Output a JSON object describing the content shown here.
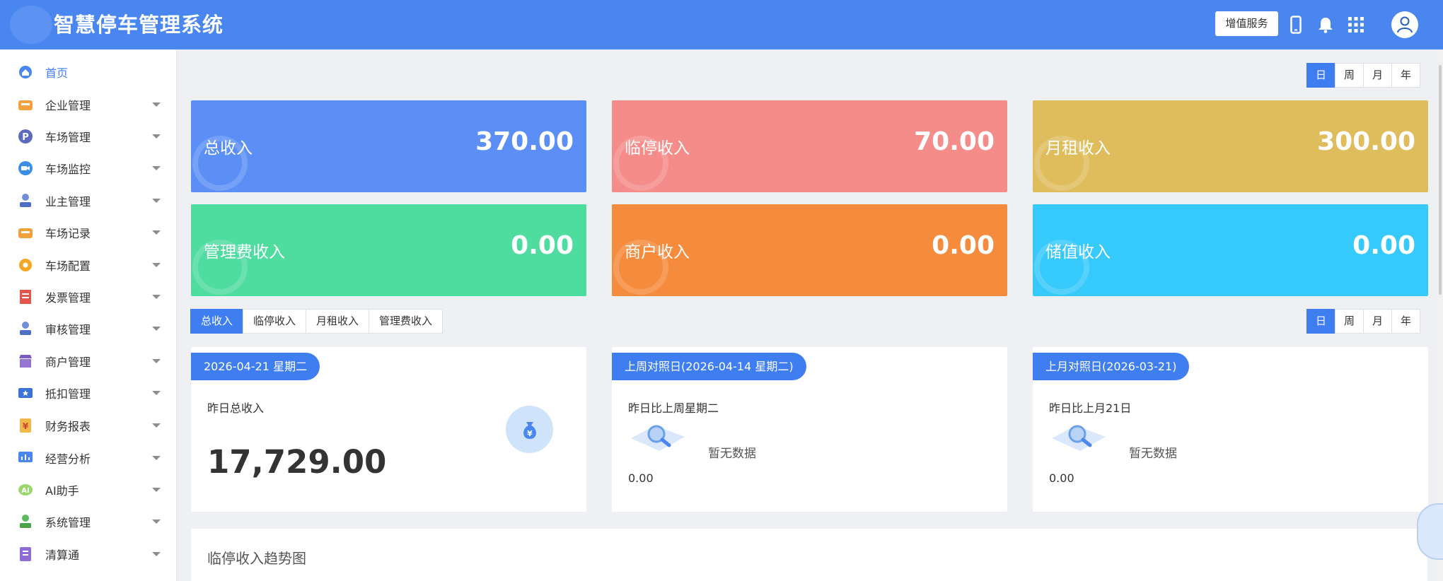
{
  "header": {
    "title": "智慧停车管理系统",
    "value_added_btn": "增值服务",
    "icons": [
      "logo-icon",
      "mobile-icon",
      "bell-icon",
      "grid-icon",
      "user-avatar-icon"
    ]
  },
  "sidebar": {
    "items": [
      {
        "label": "首页",
        "icon": "home-icon",
        "active": true,
        "has_arrow": false
      },
      {
        "label": "企业管理",
        "icon": "enterprise-icon",
        "has_arrow": true
      },
      {
        "label": "车场管理",
        "icon": "parking-icon",
        "has_arrow": true
      },
      {
        "label": "车场监控",
        "icon": "camera-icon",
        "has_arrow": true
      },
      {
        "label": "业主管理",
        "icon": "person-icon",
        "has_arrow": true
      },
      {
        "label": "车场记录",
        "icon": "car-record-icon",
        "has_arrow": true
      },
      {
        "label": "车场配置",
        "icon": "settings-icon",
        "has_arrow": true
      },
      {
        "label": "发票管理",
        "icon": "invoice-icon",
        "has_arrow": true
      },
      {
        "label": "审核管理",
        "icon": "audit-icon",
        "has_arrow": true
      },
      {
        "label": "商户管理",
        "icon": "store-icon",
        "has_arrow": true
      },
      {
        "label": "抵扣管理",
        "icon": "coupon-icon",
        "has_arrow": true
      },
      {
        "label": "财务报表",
        "icon": "finance-icon",
        "has_arrow": true
      },
      {
        "label": "经营分析",
        "icon": "analytics-icon",
        "has_arrow": true
      },
      {
        "label": "AI助手",
        "icon": "ai-icon",
        "has_arrow": true
      },
      {
        "label": "系统管理",
        "icon": "system-icon",
        "has_arrow": true
      },
      {
        "label": "清算通",
        "icon": "clearing-icon",
        "has_arrow": true
      }
    ]
  },
  "period_toggle": {
    "options": [
      "日",
      "周",
      "月",
      "年"
    ],
    "selected": "日"
  },
  "stat_cards": [
    {
      "label": "总收入",
      "value": "370.00",
      "color": "#5b8ff5"
    },
    {
      "label": "临停收入",
      "value": "70.00",
      "color": "#f48c89"
    },
    {
      "label": "月租收入",
      "value": "300.00",
      "color": "#dfbd5d"
    },
    {
      "label": "管理费收入",
      "value": "0.00",
      "color": "#4edc9f"
    },
    {
      "label": "商户收入",
      "value": "0.00",
      "color": "#f58b3d"
    },
    {
      "label": "储值收入",
      "value": "0.00",
      "color": "#36c9fb"
    }
  ],
  "income_tabs": {
    "items": [
      "总收入",
      "临停收入",
      "月租收入",
      "管理费收入"
    ],
    "selected": "总收入"
  },
  "compare_panels": [
    {
      "date_pill": "2026-04-21 星期二",
      "caption": "昨日总收入",
      "amount": "17,729.00"
    },
    {
      "date_pill": "上周对照日(2026-04-14 星期二)",
      "caption": "昨日比上周星期二",
      "no_data": "暂无数据",
      "amount": "0.00"
    },
    {
      "date_pill": "上月对照日(2026-03-21)",
      "caption": "昨日比上月21日",
      "no_data": "暂无数据",
      "amount": "0.00"
    }
  ],
  "trend": {
    "title": "临停收入趋势图"
  },
  "colors": {
    "header_bg": "#4a86f0",
    "accent": "#3f7ef0",
    "page_bg": "#eef0f3"
  }
}
